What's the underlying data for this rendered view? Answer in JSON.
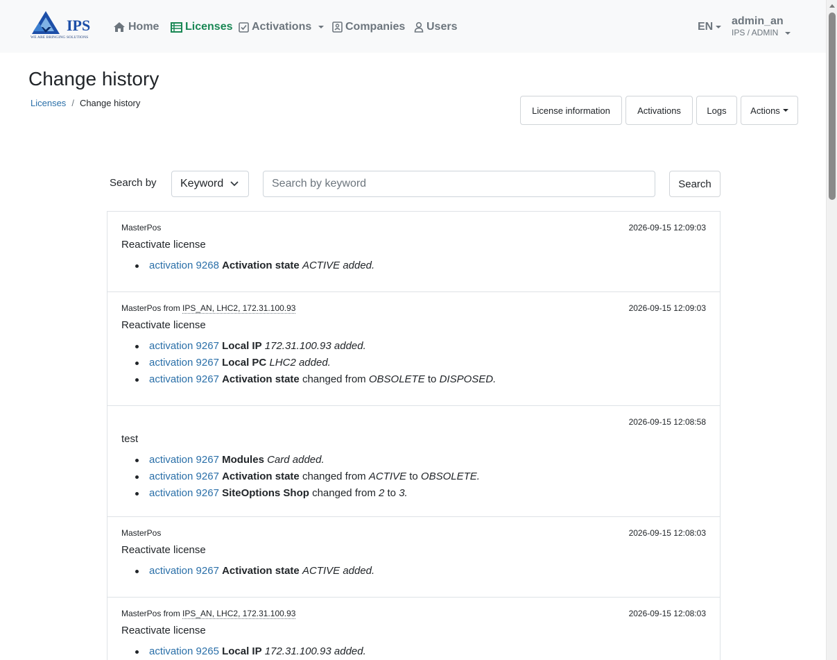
{
  "brand": {
    "name": "IPS",
    "tagline": "WE ARE BRINGING SOLUTIONS",
    "color": "#1d4fa8"
  },
  "nav": {
    "home": "Home",
    "licenses": "Licenses",
    "activations": "Activations",
    "companies": "Companies",
    "users": "Users",
    "active_color": "#198754"
  },
  "lang": "EN",
  "user": {
    "name": "admin_an",
    "role": "IPS / ADMIN"
  },
  "header": {
    "title": "Change history",
    "breadcrumb": {
      "parent": "Licenses",
      "current": "Change history"
    },
    "buttons": {
      "license_information": "License information",
      "activations": "Activations",
      "logs": "Logs",
      "actions": "Actions"
    }
  },
  "search": {
    "label": "Search by",
    "field": "Keyword",
    "placeholder": "Search by keyword",
    "button": "Search"
  },
  "entries": [
    {
      "source": "MasterPos",
      "source_detail": "",
      "time": "2026-09-15 12:09:03",
      "title": "Reactivate license",
      "changes": [
        {
          "link": "activation 9268",
          "field": "Activation state",
          "v1": "ACTIVE",
          "text": "added."
        }
      ]
    },
    {
      "source": "MasterPos from",
      "source_detail": "IPS_AN, LHC2, 172.31.100.93",
      "time": "2026-09-15 12:09:03",
      "title": "Reactivate license",
      "changes": [
        {
          "link": "activation 9267",
          "field": "Local IP",
          "v1": "172.31.100.93",
          "text": "added."
        },
        {
          "link": "activation 9267",
          "field": "Local PC",
          "v1": "LHC2",
          "text": "added."
        },
        {
          "link": "activation 9267",
          "field": "Activation state",
          "pre": "changed from",
          "from": "OBSOLETE",
          "mid": "to",
          "to": "DISPOSED."
        }
      ]
    },
    {
      "source": "",
      "source_detail": "",
      "time": "2026-09-15 12:08:58",
      "title": "test",
      "changes": [
        {
          "link": "activation 9267",
          "field": "Modules",
          "v1": "Card",
          "text": "added."
        },
        {
          "link": "activation 9267",
          "field": "Activation state",
          "pre": "changed from",
          "from": "ACTIVE",
          "mid": "to",
          "to": "OBSOLETE."
        },
        {
          "link": "activation 9267",
          "field": "SiteOptions Shop",
          "pre": "changed from",
          "from": "2",
          "mid": "to",
          "to": "3."
        }
      ]
    },
    {
      "source": "MasterPos",
      "source_detail": "",
      "time": "2026-09-15 12:08:03",
      "title": "Reactivate license",
      "changes": [
        {
          "link": "activation 9267",
          "field": "Activation state",
          "v1": "ACTIVE",
          "text": "added."
        }
      ]
    },
    {
      "source": "MasterPos from",
      "source_detail": "IPS_AN, LHC2, 172.31.100.93",
      "time": "2026-09-15 12:08:03",
      "title": "Reactivate license",
      "changes": [
        {
          "link": "activation 9265",
          "field": "Local IP",
          "v1": "172.31.100.93",
          "text": "added."
        }
      ]
    }
  ]
}
